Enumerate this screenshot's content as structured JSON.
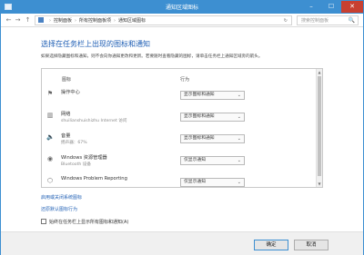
{
  "window": {
    "title": "通知区域图标",
    "minimize_glyph": "–",
    "maximize_glyph": "☐",
    "close_glyph": "✕"
  },
  "nav": {
    "back_glyph": "←",
    "forward_glyph": "→",
    "up_glyph": "↑",
    "breadcrumb": [
      "控制面板",
      "所有控制面板项",
      "通知区域图标"
    ],
    "refresh_glyph": "↻",
    "search_placeholder": "搜索控制面板",
    "search_glyph": "🔍"
  },
  "content": {
    "heading": "选择在任务栏上出现的图标和通知",
    "description": "如果选择隐藏图标和通知，则不会向你通知更改和更新。若要随时查看隐藏的图标，请单击任务栏上通知区域旁的箭头。",
    "columns": {
      "icon": "图标",
      "behavior": "行为"
    },
    "rows": [
      {
        "icon": "flag-icon",
        "glyph": "⚑",
        "name": "操作中心",
        "sub": "",
        "behavior": "显示图标和通知"
      },
      {
        "icon": "network-icon",
        "glyph": "▥",
        "name": "网络",
        "sub": "shuilianshuishizhu Internet 访问",
        "behavior": "显示图标和通知"
      },
      {
        "icon": "speaker-icon",
        "glyph": "🔈",
        "name": "音量",
        "sub": "扬声器：67%",
        "behavior": "显示图标和通知"
      },
      {
        "icon": "windows-explorer-icon",
        "glyph": "◉",
        "name": "Windows 资源管理器",
        "sub": "Bluetooth 设备",
        "behavior": "仅显示通知"
      },
      {
        "icon": "problem-reporting-icon",
        "glyph": "⬡",
        "name": "Windows Problem Reporting",
        "sub": "",
        "behavior": "仅显示通知"
      }
    ],
    "link_system_icons": "启用或关闭系统图标",
    "link_restore": "还原默认图标行为",
    "checkbox_label": "始终在任务栏上显示所有图标和通知(A)",
    "checkbox_checked": false
  },
  "footer": {
    "ok_label": "确定",
    "cancel_label": "取消"
  },
  "colors": {
    "titlebar": "#3d8fd1",
    "close_button": "#c84031",
    "link": "#1e5eb4"
  }
}
